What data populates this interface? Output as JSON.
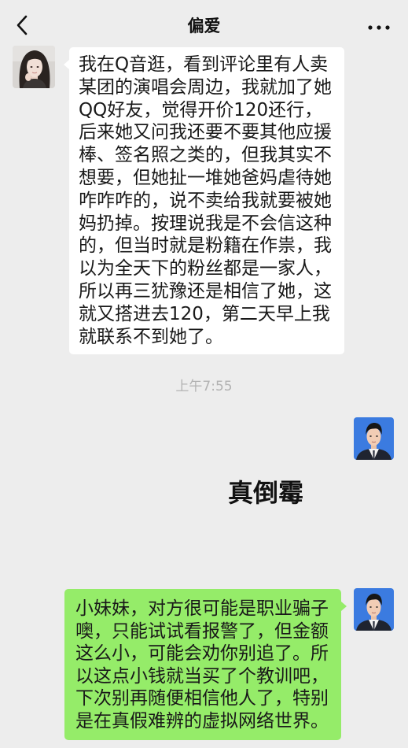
{
  "header": {
    "title": "偏爱",
    "back_icon": "chevron-left-icon",
    "more_icon": "more-dots-icon"
  },
  "colors": {
    "background": "#ededed",
    "received_bubble": "#ffffff",
    "sent_bubble": "#95ec69",
    "timestamp_text": "#b2b2b2",
    "message_text": "#191919"
  },
  "chat": {
    "received_message": {
      "lines": [
        "我在Q音逛，看到评论里有人卖",
        "某团的演唱会周边，我就加了她",
        "QQ好友，觉得开价120还行，",
        "后来她又问我还要不要其他应援",
        "棒、签名照之类的，但我其实不",
        "想要，但她扯一堆她爸妈虐待她",
        "咋咋咋的，说不卖给我就要被她",
        "妈扔掉。按理说我是不会信这种",
        "的，但当时就是粉籍在作祟，我",
        "以为全天下的粉丝都是一家人，",
        "所以再三犹豫还是相信了她，这",
        "就又搭进去120，第二天早上我",
        "就联系不到她了。"
      ]
    },
    "time_divider": "上午7:55",
    "sent_sticker": {
      "text": "真倒霉"
    },
    "sent_message": {
      "lines": [
        "小妹妹，对方很可能是职业骗子",
        "噢，只能试试看报警了，但金额",
        "这么小，可能会劝你别追了。所",
        "以这点小钱就当买了个教训吧，",
        "下次别再随便相信他人了，特别",
        "是在真假难辨的虚拟网络世界。"
      ]
    }
  }
}
